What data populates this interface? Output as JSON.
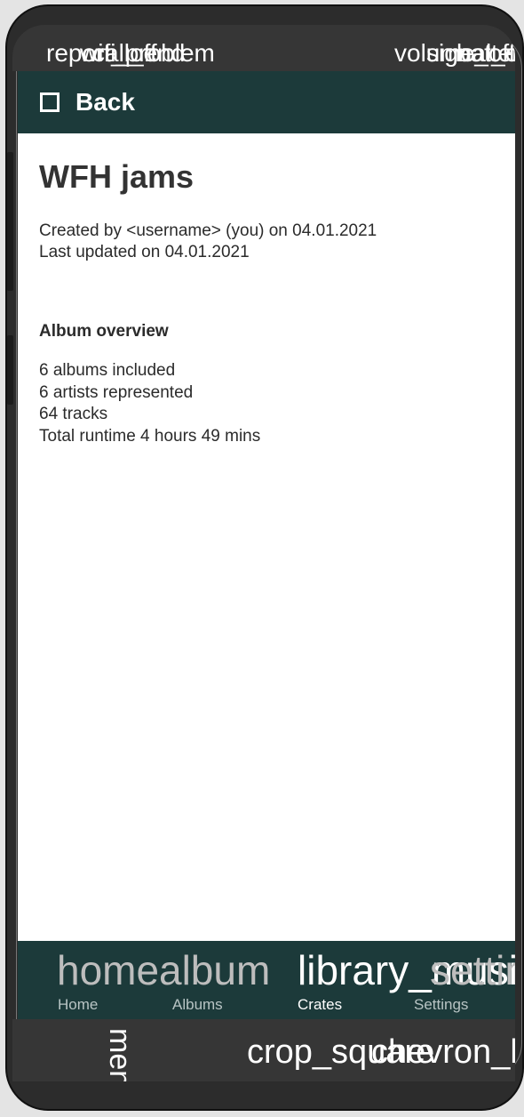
{
  "status_bar": {
    "left_icons": [
      "report_problem",
      "wifi_off",
      "call_end"
    ],
    "right_icons": [
      "volume_off",
      "signal_cellular",
      "battery"
    ]
  },
  "header": {
    "back_label": "Back"
  },
  "crate": {
    "title": "WFH jams",
    "created_line": "Created by <username> (you) on 04.01.2021",
    "updated_line": "Last updated on 04.01.2021"
  },
  "overview": {
    "heading": "Album overview",
    "albums": "6 albums included",
    "artists": "6 artists represented",
    "tracks": "64 tracks",
    "runtime": "Total runtime 4 hours 49 mins"
  },
  "bottom_nav": {
    "items": [
      {
        "icon": "home",
        "label": "Home",
        "active": false
      },
      {
        "icon": "album",
        "label": "Albums",
        "active": false
      },
      {
        "icon": "library_music",
        "label": "Crates",
        "active": true
      },
      {
        "icon": "settings",
        "label": "Settings",
        "active": false
      }
    ]
  },
  "system_nav": {
    "menu_icon": "menu",
    "home_icon": "crop_square",
    "back_icon": "chevron_left"
  },
  "colors": {
    "app_bar": "#1c3a3a",
    "phone_frame": "#363636",
    "text": "#2b2b2b"
  }
}
